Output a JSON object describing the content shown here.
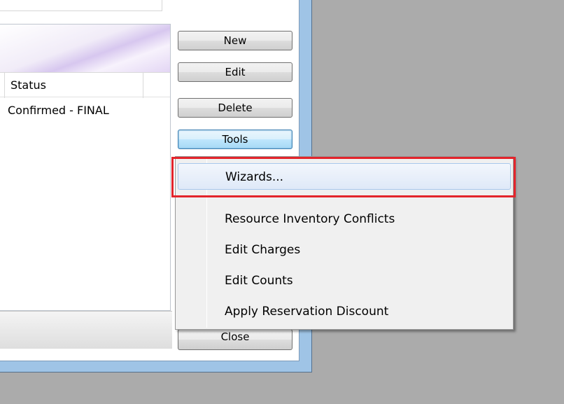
{
  "list": {
    "columns": [
      "Status"
    ],
    "rows": [
      {
        "status": "Confirmed - FINAL"
      }
    ]
  },
  "buttons": {
    "new": "New",
    "edit": "Edit",
    "delete": "Delete",
    "tools": "Tools",
    "close": "Close"
  },
  "tools_menu": {
    "items": [
      {
        "label": "Wizards...",
        "highlighted": true
      },
      {
        "label": "Resource Inventory Conflicts"
      },
      {
        "label": "Edit Charges"
      },
      {
        "label": "Edit Counts"
      },
      {
        "label": "Apply Reservation Discount"
      }
    ]
  },
  "colors": {
    "highlight_annotation": "#e3242b",
    "desktop_background": "#ababab",
    "hover_item": "#dfe9f8"
  }
}
